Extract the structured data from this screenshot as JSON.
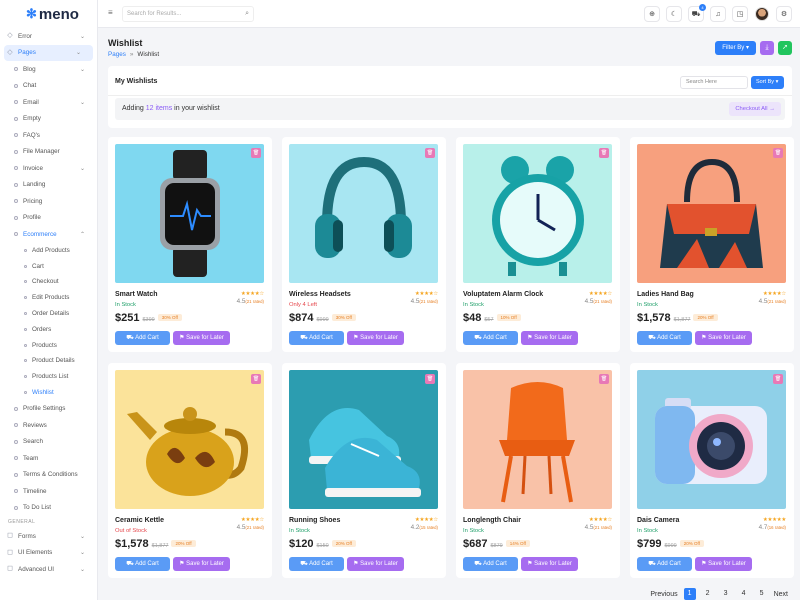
{
  "app": {
    "logo": "meno"
  },
  "sidebar": {
    "items": [
      {
        "label": "Error",
        "icon": "error-icon",
        "chevron": "⌄"
      },
      {
        "label": "Pages",
        "icon": "pages-icon",
        "chevron": "⌄"
      },
      {
        "label": "Blog",
        "sub": true,
        "chevron": "⌄"
      },
      {
        "label": "Chat",
        "sub": true
      },
      {
        "label": "Email",
        "sub": true,
        "chevron": "⌄"
      },
      {
        "label": "Empty",
        "sub": true
      },
      {
        "label": "FAQ's",
        "sub": true
      },
      {
        "label": "File Manager",
        "sub": true
      },
      {
        "label": "Invoice",
        "sub": true,
        "chevron": "⌄"
      },
      {
        "label": "Landing",
        "sub": true
      },
      {
        "label": "Pricing",
        "sub": true
      },
      {
        "label": "Profile",
        "sub": true
      },
      {
        "label": "Ecommerce",
        "sub": true,
        "chevron": "⌃"
      },
      {
        "label": "Add Products",
        "sub2": true
      },
      {
        "label": "Cart",
        "sub2": true
      },
      {
        "label": "Checkout",
        "sub2": true
      },
      {
        "label": "Edit Products",
        "sub2": true
      },
      {
        "label": "Order Details",
        "sub2": true
      },
      {
        "label": "Orders",
        "sub2": true
      },
      {
        "label": "Products",
        "sub2": true
      },
      {
        "label": "Product Details",
        "sub2": true
      },
      {
        "label": "Products List",
        "sub2": true
      },
      {
        "label": "Wishlist",
        "sub2": true
      },
      {
        "label": "Profile Settings",
        "sub": true
      },
      {
        "label": "Reviews",
        "sub": true
      },
      {
        "label": "Search",
        "sub": true
      },
      {
        "label": "Team",
        "sub": true
      },
      {
        "label": "Terms & Conditions",
        "sub": true
      },
      {
        "label": "Timeline",
        "sub": true
      },
      {
        "label": "To Do List",
        "sub": true
      }
    ],
    "section_general": "GENERAL",
    "general_items": [
      {
        "label": "Forms",
        "icon": "forms-icon",
        "chevron": "⌄"
      },
      {
        "label": "UI Elements",
        "icon": "ui-elements-icon",
        "chevron": "⌄"
      },
      {
        "label": "Advanced UI",
        "icon": "advanced-ui-icon",
        "chevron": "⌄"
      }
    ]
  },
  "header": {
    "search_placeholder": "Search for Results...",
    "cart_badge": "4"
  },
  "page": {
    "title": "Wishlist",
    "breadcrumb_parent": "Pages",
    "breadcrumb_sep": "»",
    "breadcrumb_current": "Wishlist",
    "filter_label": "Filter By"
  },
  "panel": {
    "title": "My Wishlists",
    "search_placeholder": "Search Here",
    "sort_label": "Sort By",
    "adding_prefix": "Adding",
    "adding_count": "12 items",
    "adding_suffix": "in your wishlist",
    "checkout_label": "Checkout All →"
  },
  "products": [
    {
      "name": "Smart Watch",
      "stock": "In Stock",
      "stock_color": "#22a06b",
      "stars": "★★★★☆",
      "rating": "4.5",
      "reviews": "(21 rated)",
      "price": "$251",
      "old": "$399",
      "off": "30% Off",
      "bg": "#7fd8f0"
    },
    {
      "name": "Wireless Headsets",
      "stock": "Only 4 Left",
      "stock_color": "#e5484d",
      "stars": "★★★★☆",
      "rating": "4.5",
      "reviews": "(21 rated)",
      "price": "$874",
      "old": "$999",
      "off": "30% Off",
      "bg": "#a8e6f2"
    },
    {
      "name": "Voluptatem Alarm Clock",
      "stock": "In Stock",
      "stock_color": "#22a06b",
      "stars": "★★★★☆",
      "rating": "4.5",
      "reviews": "(21 rated)",
      "price": "$48",
      "old": "$57",
      "off": "10% Off",
      "bg": "#b8f0ea"
    },
    {
      "name": "Ladies Hand Bag",
      "stock": "In Stock",
      "stock_color": "#22a06b",
      "stars": "★★★★☆",
      "rating": "4.5",
      "reviews": "(21 rated)",
      "price": "$1,578",
      "old": "$1,877",
      "off": "20% Off",
      "bg": "#f7a07e"
    },
    {
      "name": "Ceramic Kettle",
      "stock": "Out of Stock",
      "stock_color": "#e5484d",
      "stars": "★★★★☆",
      "rating": "4.5",
      "reviews": "(21 rated)",
      "price": "$1,578",
      "old": "$1,877",
      "off": "20% Off",
      "bg": "#fbe39a"
    },
    {
      "name": "Running Shoes",
      "stock": "In Stock",
      "stock_color": "#22a06b",
      "stars": "★★★★☆",
      "rating": "4.2",
      "reviews": "(15 rated)",
      "price": "$120",
      "old": "$150",
      "off": "20% Off",
      "bg": "#2c9db0"
    },
    {
      "name": "Longlength Chair",
      "stock": "In Stock",
      "stock_color": "#22a06b",
      "stars": "★★★★☆",
      "rating": "4.5",
      "reviews": "(21 rated)",
      "price": "$687",
      "old": "$879",
      "off": "14% Off",
      "bg": "#f9c2a8"
    },
    {
      "name": "Dais Camera",
      "stock": "In Stock",
      "stock_color": "#22a06b",
      "stars": "★★★★★",
      "rating": "4.7",
      "reviews": "(16 rated)",
      "price": "$799",
      "old": "$999",
      "off": "20% Off",
      "bg": "#8fd0e8"
    }
  ],
  "buttons": {
    "add_cart": "Add Cart",
    "save_later": "Save for Later"
  },
  "pagination": {
    "prev": "Previous",
    "pages": [
      "1",
      "2",
      "3",
      "4",
      "5"
    ],
    "next": "Next",
    "current": "1"
  },
  "colors": {
    "accent": "#2d7ff9",
    "purple": "#a66cf0",
    "pink": "#e879b6"
  }
}
